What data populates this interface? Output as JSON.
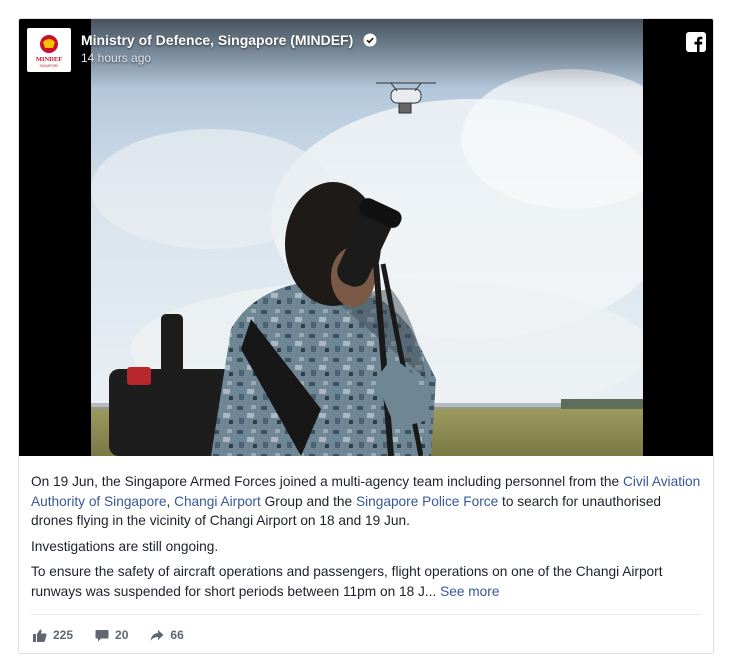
{
  "header": {
    "page_name": "Ministry of Defence, Singapore (MINDEF)",
    "timestamp": "14 hours ago",
    "logo_text": "MINDEF",
    "logo_subtext": "SINGAPORE"
  },
  "post": {
    "p1_a": "On 19 Jun, the Singapore Armed Forces joined a multi-agency team including personnel from the ",
    "p1_link1": "Civil Aviation Authority of Singapore",
    "p1_b": ", ",
    "p1_link2": "Changi Airport",
    "p1_c": " Group and the ",
    "p1_link3": "Singapore Police Force",
    "p1_d": " to search for unauthorised drones flying in the vicinity of Changi Airport on 18 and 19 Jun.",
    "p2": "Investigations are still ongoing.",
    "p3": "To ensure the safety of aircraft operations and passengers, flight operations on one of the Changi Airport runways was suspended for short periods between 11pm on 18 J...",
    "see_more": "See more"
  },
  "footer": {
    "likes": "225",
    "comments": "20",
    "shares": "66"
  },
  "colors": {
    "link": "#385898",
    "text": "#1d2129",
    "muted": "#606770",
    "mindef_red": "#c8102e"
  },
  "icons": [
    "verified-badge-icon",
    "facebook-icon",
    "like-icon",
    "comment-icon",
    "share-icon"
  ]
}
